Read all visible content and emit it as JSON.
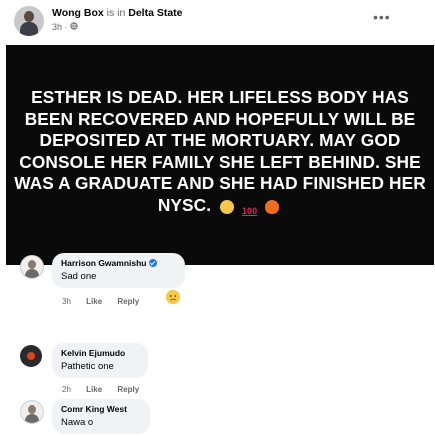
{
  "post": {
    "author": "Wong Box",
    "connector": "is in",
    "location": "Delta State",
    "time": "3h",
    "audience_icon": "globe-icon",
    "more_label": "•••",
    "status_text": "ESTHER IS DEAD. HER LIFELESS BODY HAS BEEN RECOVERED AND HOPEFULLY WILL BE DEPOSITED AT THE MORTUARY. MAY GOD CONSOLE HER FAMILY SHE LEFT BEHIND. SHE WAS A GRADUATE AND SHE HAD FINISHED HER NYSC.",
    "status_emojis": [
      "crying-face-icon",
      "hundred-points-icon",
      "fire-icon"
    ],
    "hundred": "100",
    "background_color": "#0a0a0a"
  },
  "comments": [
    {
      "author": "Harrison Gwamnishu",
      "verified": true,
      "text": "Sad one",
      "time": "3h",
      "like_label": "Like",
      "reply_label": "Reply",
      "reaction": "sad-face-icon"
    },
    {
      "author": "Kelvin Ejumudo",
      "verified": false,
      "text": "Pathetic one",
      "time": "2h",
      "like_label": "Like",
      "reply_label": "Reply"
    },
    {
      "author": "Comr King West",
      "verified": false,
      "text": "Nawa o"
    }
  ],
  "colors": {
    "muted": "#65676b",
    "bubble": "#f0f2f5",
    "verified": "#1877f2"
  }
}
